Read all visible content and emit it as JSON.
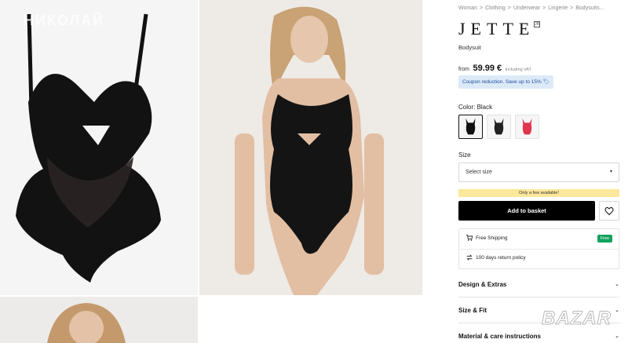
{
  "watermarks": {
    "top_left": "НИКОЛАЙ",
    "bottom_right": "BAZAR"
  },
  "breadcrumb": [
    "Woman",
    ">",
    "Clothing",
    ">",
    "Underwear",
    ">",
    "Lingerie",
    ">",
    "Bodysuits..."
  ],
  "product": {
    "brand": "JETTE",
    "brand_badge": "JB",
    "type": "Bodysuit",
    "price_from": "from",
    "price": "59.99 €",
    "price_vat": "Including VAT",
    "coupon": "Coupon reduction. Save up to 15% 🏷"
  },
  "color": {
    "label": "Color: Black",
    "swatches": [
      "black",
      "black",
      "red"
    ],
    "selected_index": 0
  },
  "size": {
    "label": "Size",
    "placeholder": "Select size"
  },
  "stock_notice": "Only a few available!",
  "actions": {
    "add_to_basket": "Add to basket",
    "wishlist_icon": "heart-icon"
  },
  "shipping": {
    "free_shipping": "Free Shipping",
    "free_badge": "Free",
    "return_policy": "100 days return policy",
    "icons": [
      "cart-icon",
      "return-arrows-icon"
    ]
  },
  "accordions": [
    "Design & Extras",
    "Size & Fit",
    "Material & care instructions"
  ],
  "colors": {
    "primary_button": "#000000",
    "coupon_bg": "#dceaf8",
    "stock_bg": "#fde79a",
    "free_badge": "#12a15e",
    "swatch_red": "#e0344f"
  }
}
